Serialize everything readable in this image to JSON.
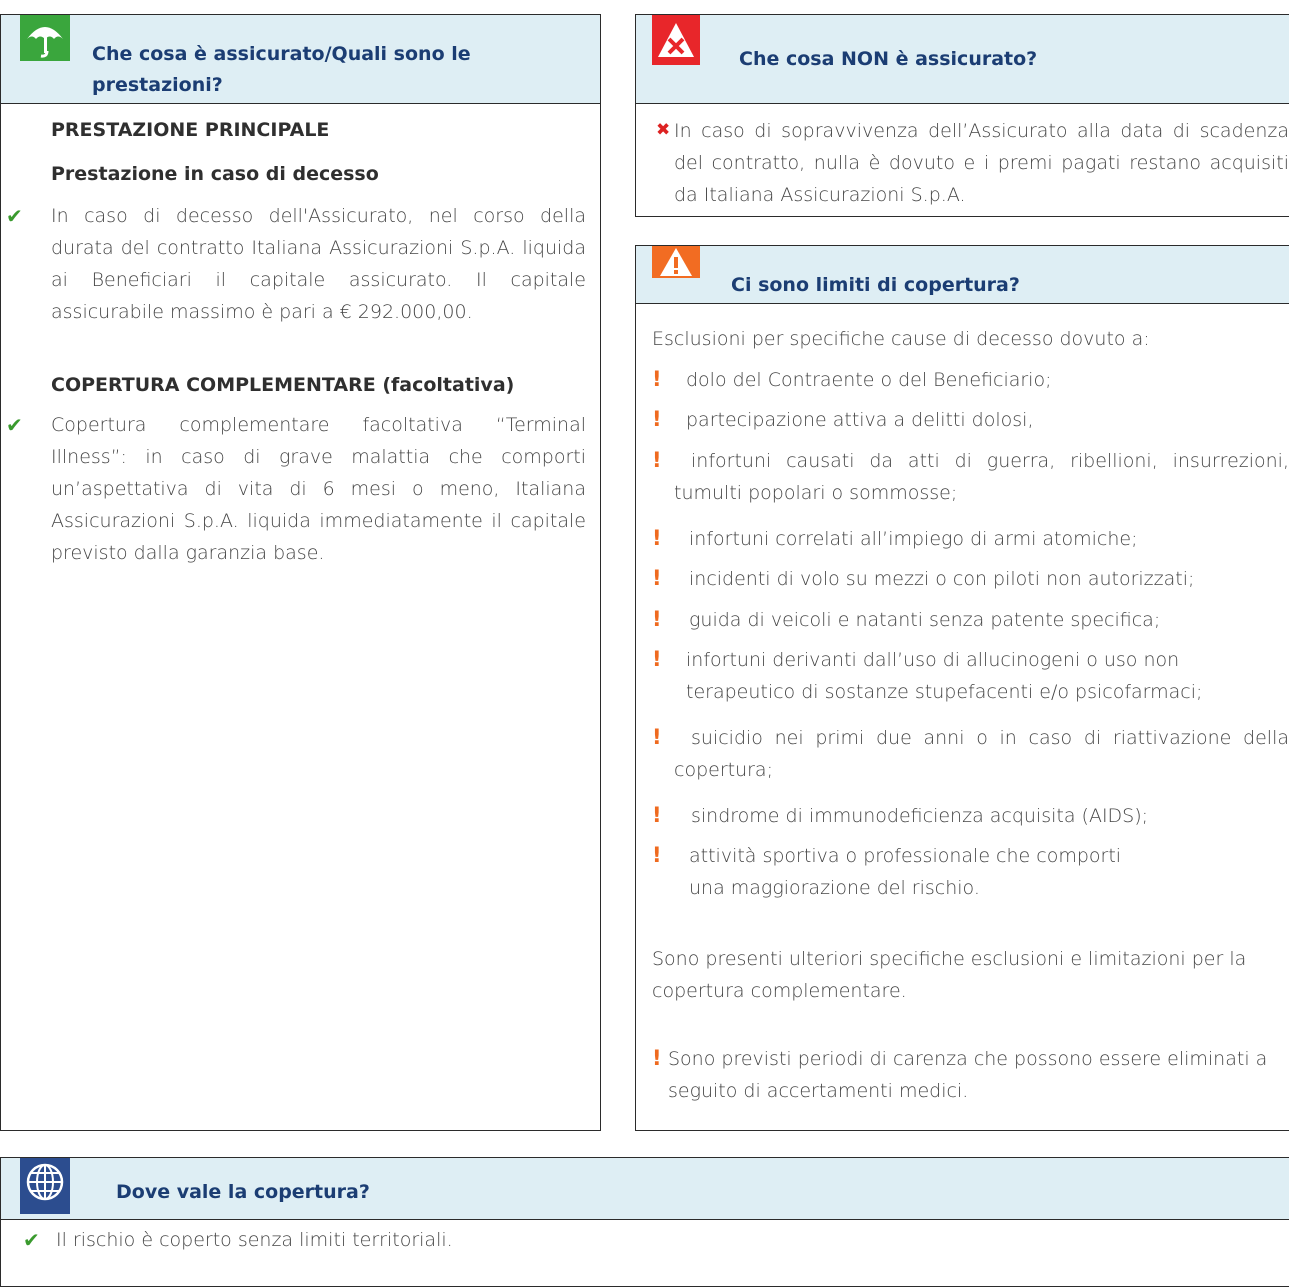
{
  "left": {
    "header": "Che cosa è assicurato/Quali sono le prestazioni?",
    "section1_title": "PRESTAZIONE PRINCIPALE",
    "section1_sub": "Prestazione in caso di decesso",
    "section1_text": "In caso di decesso dell'Assicurato, nel corso della durata del contratto Italiana Assicurazioni S.p.A. liquida ai Beneficiari il capitale assicurato. Il capitale assicurabile massimo è pari a € 292.000,00.",
    "section2_title": "COPERTURA COMPLEMENTARE (facoltativa)",
    "section2_text": "Copertura complementare facoltativa “Terminal Illness”: in caso di grave malattia che comporti un’aspettativa di vita di 6 mesi o meno, Italiana Assicurazioni S.p.A. liquida immediatamente il capitale previsto dalla garanzia base."
  },
  "not_insured": {
    "header": "Che cosa NON è assicurato?",
    "text": "In caso di sopravvivenza dell’Assicurato alla data di scadenza del contratto, nulla è dovuto e i premi pagati restano acquisiti da Italiana Assicurazioni S.p.A."
  },
  "limits": {
    "header": "Ci sono limiti di copertura?",
    "intro": "Esclusioni per specifiche cause di decesso dovuto a:",
    "items": [
      "dolo del Contraente o del Beneficiario;",
      "partecipazione attiva a delitti dolosi,",
      "infortuni causati da atti di guerra, ribellioni, insurrezioni, tumulti popolari o sommosse;",
      "infortuni correlati all’impiego di armi atomiche;",
      "incidenti di volo su mezzi o con piloti non autorizzati;",
      "guida di veicoli e natanti senza patente specifica;",
      "infortuni derivanti dall’uso di allucinogeni o uso non terapeutico di sostanze stupefacenti e/o psicofarmaci;",
      "suicidio nei primi due anni o in caso di riattivazione della copertura;",
      "sindrome di immunodeficienza acquisita (AIDS);",
      "attività sportiva o professionale che comporti una maggiorazione del rischio."
    ],
    "note": "Sono presenti ulteriori specifiche esclusioni e limitazioni per la copertura complementare.",
    "waiting": "Sono previsti periodi di carenza che possono essere eliminati a seguito di accertamenti medici."
  },
  "where": {
    "header": "Dove vale la copertura?",
    "text": "Il rischio è coperto senza limiti territoriali."
  },
  "icons": {
    "umbrella": "umbrella-icon",
    "x": "x-warning-icon",
    "alert": "alert-triangle-icon",
    "globe": "globe-icon"
  },
  "colors": {
    "header_bg": "#deeef4",
    "title": "#1b3d73",
    "check": "#3a9a2e",
    "exclamation": "#ef6a1f",
    "x": "#dd2222"
  }
}
